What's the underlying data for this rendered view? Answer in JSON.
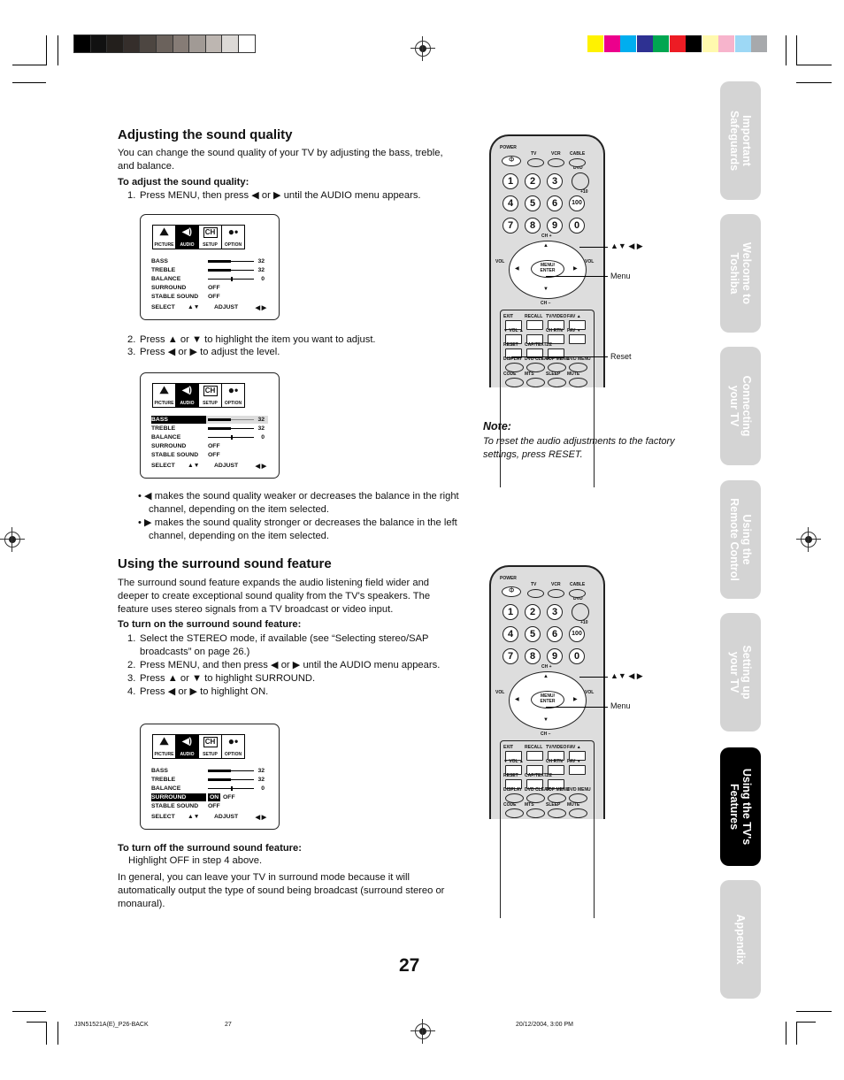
{
  "print_marks": {
    "gray_swatches": [
      "#000000",
      "#111111",
      "#231f1c",
      "#352e2b",
      "#4d4641",
      "#6b625c",
      "#867c76",
      "#a19a95",
      "#bdb6b1",
      "#dcd9d6",
      "#ffffff"
    ],
    "color_swatches": [
      "#fff200",
      "#ec008c",
      "#00aeef",
      "#2e3192",
      "#00a651",
      "#ed1c24",
      "#000000",
      "#fff9ae",
      "#f7b4cc",
      "#9dd8f5",
      "#a7a9ac"
    ]
  },
  "section1": {
    "title": "Adjusting the sound quality",
    "intro": "You can change the sound quality of your TV by adjusting the bass, treble, and balance.",
    "subhead": "To adjust the sound quality:",
    "step1": {
      "num": "1.",
      "text": "Press MENU, then press ◀ or ▶ until the AUDIO menu appears."
    },
    "step2": {
      "num": "2.",
      "text": "Press ▲ or ▼ to highlight the item you want to adjust."
    },
    "step3": {
      "num": "3.",
      "text": "Press ◀ or ▶ to adjust the level."
    },
    "bullet1": "◀  makes the sound quality weaker or decreases the balance in the right channel, depending on the item selected.",
    "bullet2": "▶ makes the sound quality stronger or decreases the balance in the left channel, depending on the item selected."
  },
  "osd": {
    "icons": [
      {
        "name": "picture",
        "label": "PICTURE"
      },
      {
        "name": "audio",
        "label": "AUDIO"
      },
      {
        "name": "setup",
        "label": "SETUP",
        "glyph": "CH"
      },
      {
        "name": "option",
        "label": "OPTION"
      }
    ],
    "items": {
      "bass": {
        "label": "BASS",
        "value": "32",
        "level": 0.5
      },
      "treble": {
        "label": "TREBLE",
        "value": "32",
        "level": 0.5
      },
      "balance": {
        "label": "BALANCE",
        "value": "0",
        "level": 0.5
      },
      "surround": {
        "label": "SURROUND",
        "value": "OFF"
      },
      "stable": {
        "label": "STABLE SOUND",
        "value": "OFF"
      }
    },
    "surround_on": "ON",
    "surround_off": "OFF",
    "footer": {
      "select": "SELECT",
      "select_keys": "▲▼",
      "adjust": "ADJUST",
      "adjust_keys": "◀ ▶"
    }
  },
  "section2": {
    "title": "Using the surround sound feature",
    "intro": "The surround sound feature expands the audio listening field wider and deeper to create exceptional sound quality from the TV's speakers. The feature uses stereo signals from a TV broadcast or video input.",
    "subhead_on": "To turn on the surround sound feature:",
    "steps": [
      {
        "num": "1.",
        "text": "Select the STEREO mode, if available (see “Selecting stereo/SAP broadcasts” on page 26.)"
      },
      {
        "num": "2.",
        "text": "Press MENU, and then press ◀ or ▶ until the AUDIO menu appears."
      },
      {
        "num": "3.",
        "text": "Press ▲ or ▼ to highlight SURROUND."
      },
      {
        "num": "4.",
        "text": "Press ◀ or ▶ to highlight ON."
      }
    ],
    "subhead_off": "To turn off the surround sound feature:",
    "off_text": "Highlight OFF in step 4 above.",
    "closing": "In general, you can leave your TV in surround mode because it will automatically output the type of sound being broadcast (surround stereo or monaural)."
  },
  "note": {
    "title": "Note:",
    "text": "To reset the audio adjustments to the factory settings, press RESET."
  },
  "remote": {
    "top_labels": {
      "power": "POWER",
      "tv": "TV",
      "vcr": "VCR",
      "cable": "CABLE",
      "dvd": "DVD",
      "plus10": "+10"
    },
    "digits": [
      "1",
      "2",
      "3",
      "",
      "4",
      "5",
      "6",
      "100",
      "7",
      "8",
      "9",
      "0"
    ],
    "ch_plus": "CH +",
    "ch_minus": "CH –",
    "vol": "VOL",
    "menu_enter": "MENU/ ENTER",
    "row1": [
      "EXIT",
      "RECALL",
      "TV/VIDEO",
      "FAV ▲"
    ],
    "row2": [
      "▼  VOL  ▲",
      "",
      "CH RTN",
      "FAV ▼"
    ],
    "row3": [
      "RESET",
      "CAP/TEXT",
      "1/2"
    ],
    "row4": [
      "DISPLAY",
      "DVD CLEAR",
      "TOP MENU",
      "DVD MENU"
    ],
    "row5": [
      "CODE",
      "MTS",
      "SLEEP",
      "MUTE"
    ],
    "callouts": {
      "arrows": "▲▼ ◀ ▶",
      "menu": "Menu",
      "reset": "Reset"
    }
  },
  "side_tabs": [
    {
      "label": "Important\nSafeguards",
      "active": false
    },
    {
      "label": "Welcome to\nToshiba",
      "active": false
    },
    {
      "label": "Connecting\nyour TV",
      "active": false
    },
    {
      "label": "Using the\nRemote Control",
      "active": false
    },
    {
      "label": "Setting up\nyour TV",
      "active": false
    },
    {
      "label": "Using the TV's\nFeatures",
      "active": true
    },
    {
      "label": "Appendix",
      "active": false
    }
  ],
  "page_number": "27",
  "footer": {
    "file": "J3N51521A(E)_P26-BACK",
    "page": "27",
    "date": "20/12/2004, 3:00 PM"
  }
}
